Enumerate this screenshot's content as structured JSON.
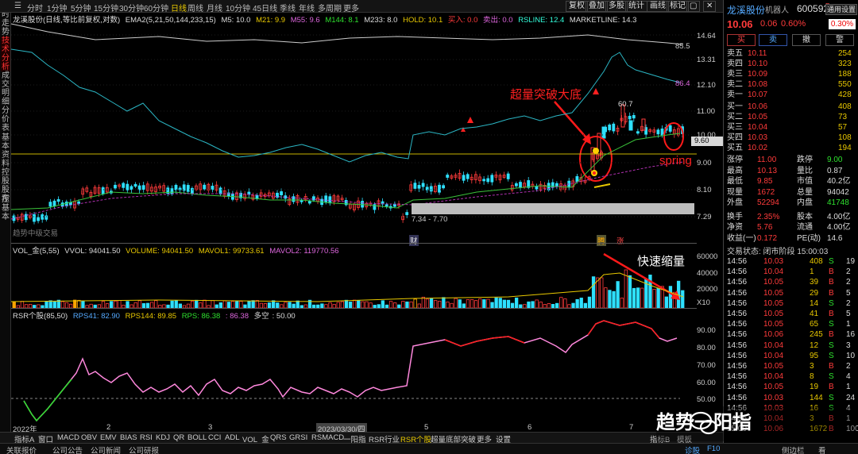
{
  "periods": [
    "分时",
    "1分钟",
    "5分钟",
    "15分钟",
    "30分钟",
    "60分钟",
    "日线",
    "周线",
    "月线",
    "10分钟",
    "45日线",
    "季线",
    "年线",
    "多周期",
    "更多"
  ],
  "active_period": "日线",
  "toolbar_buttons": [
    "复权",
    "叠加",
    "多股",
    "统计",
    "画线",
    "标记"
  ],
  "window_icons": [
    "▢",
    "✕"
  ],
  "left_tabs": [
    "分时走势",
    "技术分析",
    "成交明细",
    "分价表",
    "基本资料",
    "控股股东",
    "控基本"
  ],
  "active_left_tab": "技术分析",
  "main_legend": {
    "name": "龙溪股份(日线,等比前复权,对数)",
    "ema2": "EMA2(5,21,50,144,233,15)",
    "m5": "M5: 10.0",
    "m21": "M21: 9.9",
    "m55": "M55: 9.6",
    "m144": "M144: 8.1",
    "m233": "M233: 8.0",
    "hold": "HOLD: 10.1",
    "buy": "买入: 0.0",
    "sell": "卖出: 0.0",
    "rsline": "RSLINE: 12.4",
    "mktline": "MARKETLINE: 14.3"
  },
  "main_axis": [
    "14.64",
    "13.31",
    "12.10",
    "11.00",
    "10.00",
    "9.00",
    "8.10",
    "7.29"
  ],
  "level_price": "9.60",
  "rs_labels": {
    "a": "85.5",
    "b": "86.4"
  },
  "price_labels": {
    "high": "60.7",
    "range": "7.34 - 7.70",
    "watermark": "趋势中级交易"
  },
  "event_markers": [
    "财",
    "腾",
    "涨"
  ],
  "annotations": {
    "breakout": "超量突破大底",
    "spring": "spring",
    "shrink": "快速缩量"
  },
  "volume_legend": {
    "name": "VOL_金(5,55)",
    "vvol": "VVOL: 94041.50",
    "volume": "VOLUME: 94041.50",
    "mavol1": "MAVOL1: 99733.61",
    "mavol2": "MAVOL2: 119770.56"
  },
  "volume_axis": [
    "60000",
    "40000",
    "20000"
  ],
  "volume_unit": "X10",
  "rsi_legend": {
    "name": "RSR个股(85,50)",
    "rps41": "RPS41: 82.90",
    "rps144": "RPS144: 89.85",
    "rps": "RPS: 86.38",
    "rps2": ": 86.38",
    "duokong": ": 50.00",
    "dk_label": "多空"
  },
  "rsi_axis": [
    "90.00",
    "80.00",
    "70.00",
    "60.00",
    "50.00"
  ],
  "x_axis": [
    "2022年",
    "2",
    "3",
    "2023/03/30/四",
    "5",
    "6",
    "7"
  ],
  "bottom_tabs": [
    "指标A",
    "窗口",
    "MACD",
    "OBV",
    "EMV",
    "BIAS",
    "RSI",
    "KDJ",
    "QR",
    "BOLL",
    "CCI",
    "ADL",
    "VOL_金",
    "QRS",
    "GRSI",
    "RSMACD",
    "一阳指",
    "RSR行业",
    "RSR个股",
    "超量底部突破",
    "更多",
    "设置"
  ],
  "active_bottom_tab": "RSR个股",
  "bottom_right": [
    "指标B",
    "模板"
  ],
  "footer": [
    "关联报价",
    "公司公告",
    "公司新闻",
    "公司研报"
  ],
  "footer_right": [
    "诊股",
    "F10",
    "侧边栏",
    "看"
  ],
  "colors": {
    "up": "#ff3b3b",
    "down": "#2ee0ff",
    "rs_line": "#2bb6c4",
    "ma_green": "#3ac23a",
    "ma_mag": "#b030b0",
    "level": "#c8b400",
    "rsi_pink": "#ff88dd",
    "rsi_red": "#ff2020",
    "rsi_green": "#2ee02e"
  },
  "quote": {
    "title": "龙溪股份",
    "subtitle": "机器人",
    "code": "600592",
    "tag": "R",
    "settings": "通用设置",
    "price": "10.06",
    "change": "0.06",
    "pct": "0.60%",
    "badge": "0.30%",
    "actions": [
      {
        "label": "买",
        "color": "#ff4040"
      },
      {
        "label": "卖",
        "color": "#5af"
      },
      {
        "label": "撤",
        "color": "#ddd"
      },
      {
        "label": "警",
        "color": "#ddd"
      }
    ],
    "sells": [
      {
        "label": "卖五",
        "price": "10.11",
        "vol": "254"
      },
      {
        "label": "卖四",
        "price": "10.10",
        "vol": "323"
      },
      {
        "label": "卖三",
        "price": "10.09",
        "vol": "188"
      },
      {
        "label": "卖二",
        "price": "10.08",
        "vol": "550"
      },
      {
        "label": "卖一",
        "price": "10.07",
        "vol": "428"
      }
    ],
    "buys": [
      {
        "label": "买一",
        "price": "10.06",
        "vol": "408"
      },
      {
        "label": "买二",
        "price": "10.05",
        "vol": "73"
      },
      {
        "label": "买三",
        "price": "10.04",
        "vol": "57"
      },
      {
        "label": "买四",
        "price": "10.03",
        "vol": "108"
      },
      {
        "label": "买五",
        "price": "10.02",
        "vol": "194"
      }
    ],
    "stats": [
      [
        "涨停",
        "11.00",
        "跌停",
        "9.00"
      ],
      [
        "最高",
        "10.13",
        "量比",
        "0.87"
      ],
      [
        "最低",
        "9.85",
        "市值",
        "40.2亿"
      ],
      [
        "现量",
        "1672",
        "总量",
        "94042"
      ],
      [
        "外盘",
        "52294",
        "内盘",
        "41748"
      ],
      [
        "换手",
        "2.35%",
        "股本",
        "4.00亿"
      ],
      [
        "净资",
        "5.76",
        "流通",
        "4.00亿"
      ],
      [
        "收益(一)",
        "0.172",
        "PE(动)",
        "14.6"
      ]
    ],
    "trade_status": "交易状态: 闭市阶段 15:00:03",
    "trades": [
      [
        "14:56",
        "10.03",
        "408",
        "S",
        "19"
      ],
      [
        "14:56",
        "10.04",
        "1",
        "B",
        "2"
      ],
      [
        "14:56",
        "10.05",
        "39",
        "B",
        "2"
      ],
      [
        "14:56",
        "10.05",
        "29",
        "B",
        "5"
      ],
      [
        "14:56",
        "10.05",
        "14",
        "S",
        "2"
      ],
      [
        "14:56",
        "10.05",
        "41",
        "B",
        "5"
      ],
      [
        "14:56",
        "10.05",
        "65",
        "S",
        "1"
      ],
      [
        "14:56",
        "10.06",
        "245",
        "B",
        "16"
      ],
      [
        "14:56",
        "10.04",
        "12",
        "S",
        "3"
      ],
      [
        "14:56",
        "10.04",
        "95",
        "S",
        "10"
      ],
      [
        "14:56",
        "10.05",
        "3",
        "B",
        "2"
      ],
      [
        "14:56",
        "10.04",
        "8",
        "S",
        "4"
      ],
      [
        "14:56",
        "10.05",
        "19",
        "B",
        "1"
      ],
      [
        "14:56",
        "10.03",
        "144",
        "S",
        "24"
      ],
      [
        "14:56",
        "10.03",
        "16",
        "S",
        "4"
      ],
      [
        "14:56",
        "10.04",
        "3",
        "B",
        "1"
      ],
      [
        "15:00",
        "10.06",
        "1672",
        "B",
        "100"
      ]
    ]
  },
  "watermark_caption": "趋势一阳指"
}
